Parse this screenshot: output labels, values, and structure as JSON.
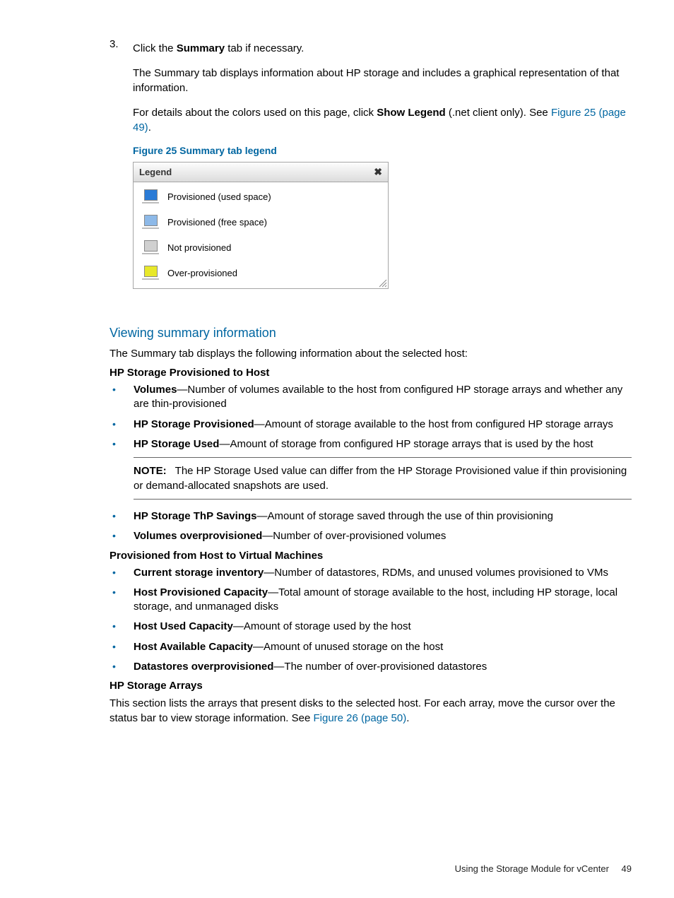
{
  "step": {
    "number": "3.",
    "line1_pre": "Click the ",
    "line1_bold": "Summary",
    "line1_post": " tab if necessary.",
    "para1": "The Summary tab displays information about HP storage and includes a graphical representation of that information.",
    "para2_pre": "For details about the colors used on this page, click ",
    "para2_bold": "Show Legend",
    "para2_post": " (.net client only). See ",
    "para2_link": "Figure 25 (page 49)",
    "para2_end": "."
  },
  "figure25": {
    "caption": "Figure 25 Summary tab legend",
    "title": "Legend",
    "items": [
      {
        "label": "Provisioned (used space)",
        "color": "#2a7bd6"
      },
      {
        "label": "Provisioned (free space)",
        "color": "#8db9e8"
      },
      {
        "label": "Not provisioned",
        "color": "#d0d0d0"
      },
      {
        "label": "Over-provisioned",
        "color": "#e8e82a"
      }
    ]
  },
  "viewing": {
    "heading": "Viewing summary information",
    "intro": "The Summary tab displays the following information about the selected host:"
  },
  "sec1": {
    "title": "HP Storage Provisioned to Host",
    "b1_term": "Volumes",
    "b1_desc": "—Number of volumes available to the host from configured HP storage arrays and whether any are thin-provisioned",
    "b2_term": "HP Storage Provisioned",
    "b2_desc": "—Amount of storage available to the host from configured HP storage arrays",
    "b3_term": "HP Storage Used",
    "b3_desc": "—Amount of storage from configured HP storage arrays that is used by the host",
    "note_label": "NOTE:",
    "note_text": "The HP Storage Used value can differ from the HP Storage Provisioned value if thin provisioning or demand-allocated snapshots are used.",
    "b4_term": "HP Storage ThP Savings",
    "b4_desc": "—Amount of storage saved through the use of thin provisioning",
    "b5_term": "Volumes overprovisioned",
    "b5_desc": "—Number of over-provisioned volumes"
  },
  "sec2": {
    "title": "Provisioned from Host to Virtual Machines",
    "b1_term": "Current storage inventory",
    "b1_desc": "—Number of datastores, RDMs, and unused volumes provisioned to VMs",
    "b2_term": "Host Provisioned Capacity",
    "b2_desc": "—Total amount of storage available to the host, including HP storage, local storage, and unmanaged disks",
    "b3_term": "Host Used Capacity",
    "b3_desc": "—Amount of storage used by the host",
    "b4_term": "Host Available Capacity",
    "b4_desc": "—Amount of unused storage on the host",
    "b5_term": "Datastores overprovisioned",
    "b5_desc": "—The number of over-provisioned datastores"
  },
  "sec3": {
    "title": "HP Storage Arrays",
    "para_pre": "This section lists the arrays that present disks to the selected host. For each array, move the cursor over the status bar to view storage information. See ",
    "para_link": "Figure 26 (page 50)",
    "para_end": "."
  },
  "footer": {
    "text": "Using the Storage Module for vCenter",
    "page": "49"
  }
}
